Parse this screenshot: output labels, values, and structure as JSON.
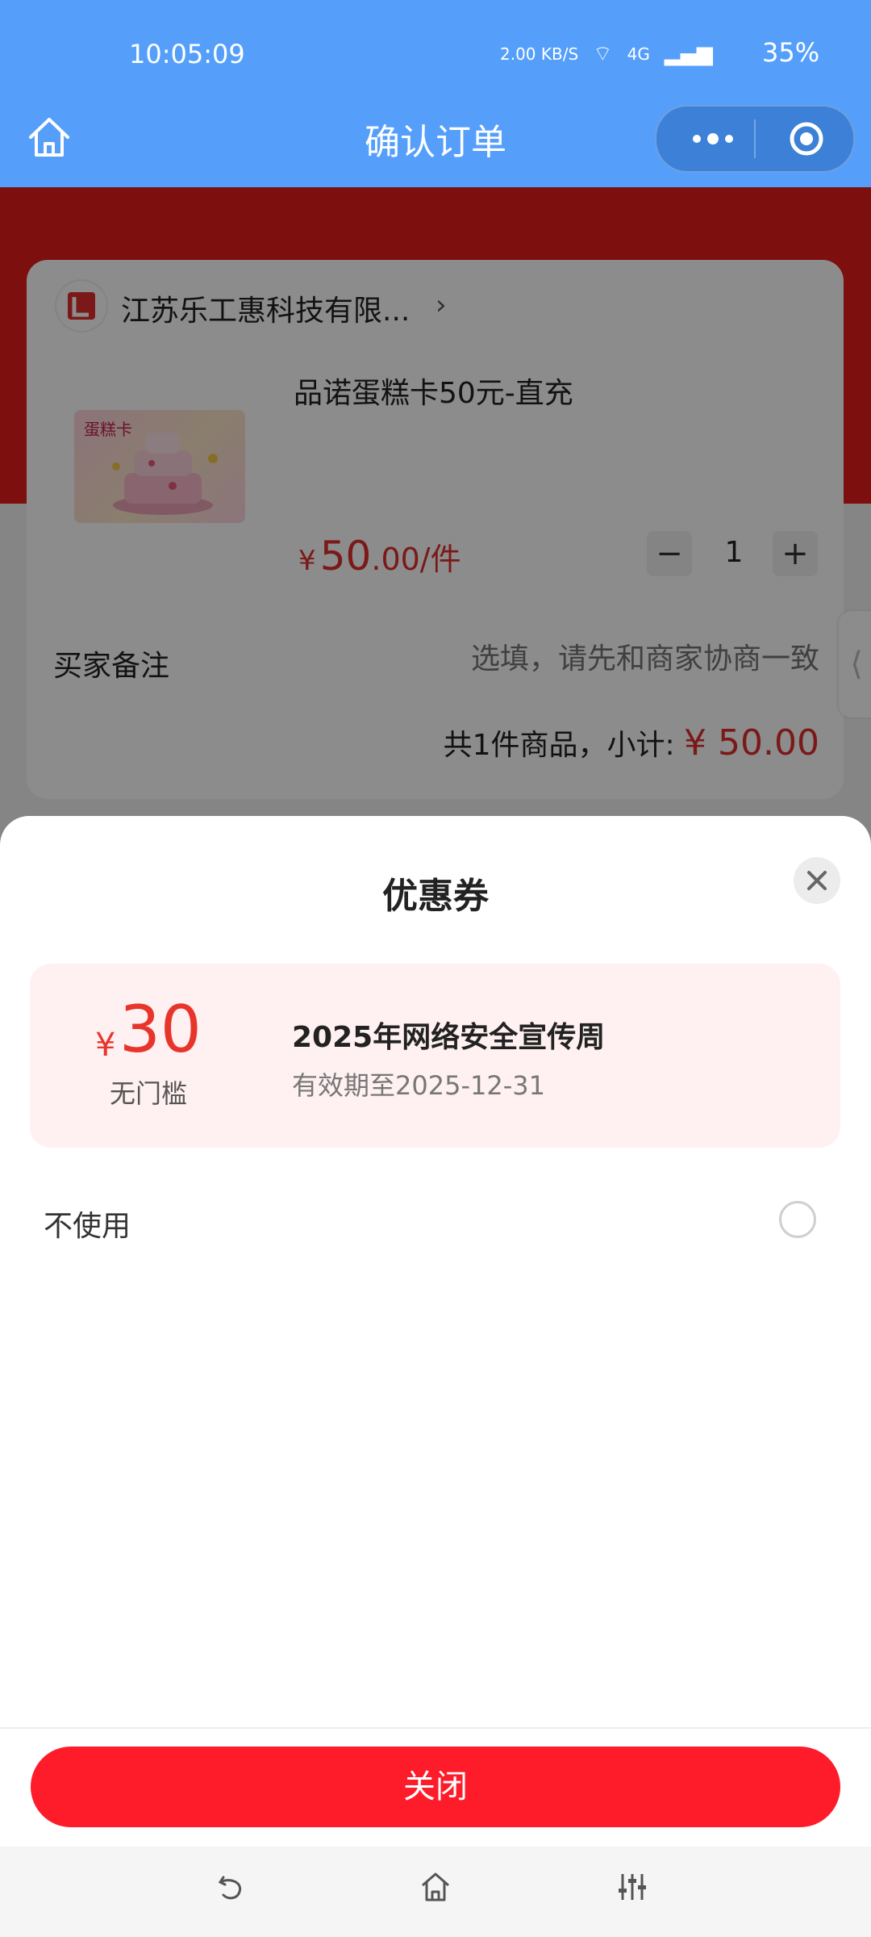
{
  "status_bar": {
    "time": "10:05:09",
    "net_speed": "2.00 KB/S",
    "signal": "4G",
    "battery": "35%"
  },
  "nav": {
    "title": "确认订单",
    "home_icon": "home-icon",
    "more_icon": "more-dots-icon",
    "exit_icon": "target-circle-icon"
  },
  "order": {
    "shop_name": "江苏乐工惠科技有限...",
    "product_name": "品诺蛋糕卡50元-直充",
    "product_image_label": "蛋糕卡",
    "price_symbol": "¥",
    "price_int": "50",
    "price_dec": ".00/件",
    "quantity": "1",
    "minus": "−",
    "plus": "+",
    "remark_label": "买家备注",
    "remark_placeholder": "选填，请先和商家协商一致",
    "subtotal_label": "共1件商品，小计: ",
    "subtotal_amount": "¥ 50.00"
  },
  "coupon_sheet": {
    "title": "优惠券",
    "coupons": [
      {
        "symbol": "¥",
        "amount": "30",
        "condition": "无门槛",
        "name": "2025年网络安全宣传周",
        "validity": "有效期至2025-12-31"
      }
    ],
    "no_use_label": "不使用",
    "close_button": "关闭"
  },
  "colors": {
    "nav_blue": "#559ffb",
    "brand_red": "#e31d1c",
    "price_red": "#e02e2e",
    "button_red": "#fe1b2a",
    "coupon_bg": "#fff0f1"
  }
}
